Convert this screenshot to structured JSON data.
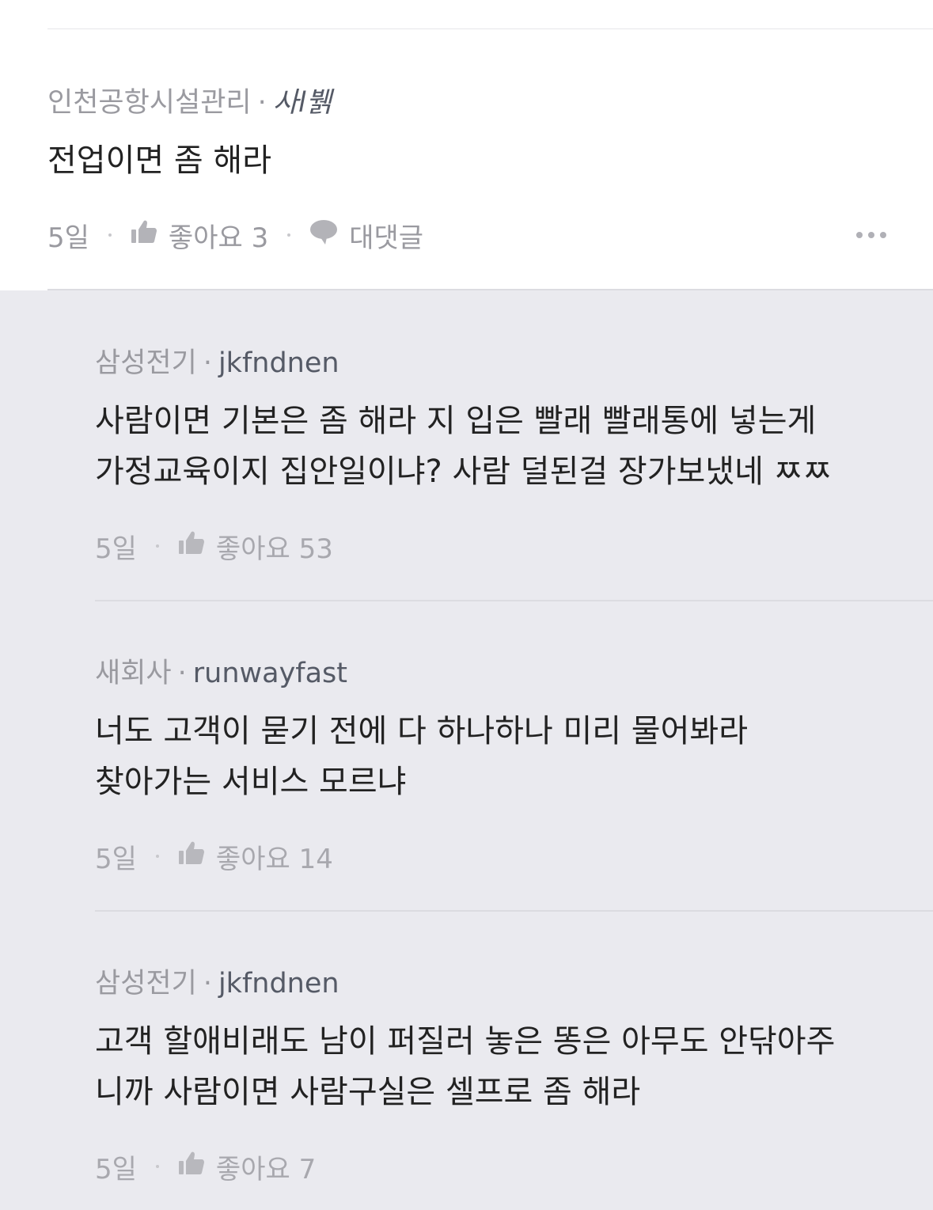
{
  "main_comment": {
    "company": "인천공항시설관리",
    "author": "사l뷁",
    "text": "전업이면 좀 해라",
    "time": "5일",
    "like_label": "좋아요 3",
    "reply_label": "대댓글"
  },
  "replies": [
    {
      "company": "삼성전기",
      "author": "jkfndnen",
      "lines": [
        "사람이면 기본은 좀 해라 지 입은 빨래 빨래통에 넣는게",
        "가정교육이지 집안일이냐? 사람 덜된걸 장가보냈네 ㅉㅉ"
      ],
      "time": "5일",
      "like_label": "좋아요 53"
    },
    {
      "company": "새회사",
      "author": "runwayfast",
      "lines": [
        "너도 고객이 묻기 전에 다 하나하나 미리 물어봐라",
        "찾아가는 서비스 모르냐"
      ],
      "time": "5일",
      "like_label": "좋아요 14"
    },
    {
      "company": "삼성전기",
      "author": "jkfndnen",
      "lines": [
        "고객 할애비래도 남이 퍼질러 놓은 똥은 아무도 안닦아주",
        "니까 사람이면 사람구실은 셀프로 좀 해라"
      ],
      "time": "5일",
      "like_label": "좋아요 7"
    }
  ],
  "meta_separator": "·",
  "icons": {
    "like": "thumbs-up-icon",
    "reply": "speech-bubble-icon",
    "more": "more-dots-icon"
  },
  "colors": {
    "reply_background": "#eaeaef",
    "muted_text": "#9a9aa0",
    "author_text": "#555a66"
  }
}
